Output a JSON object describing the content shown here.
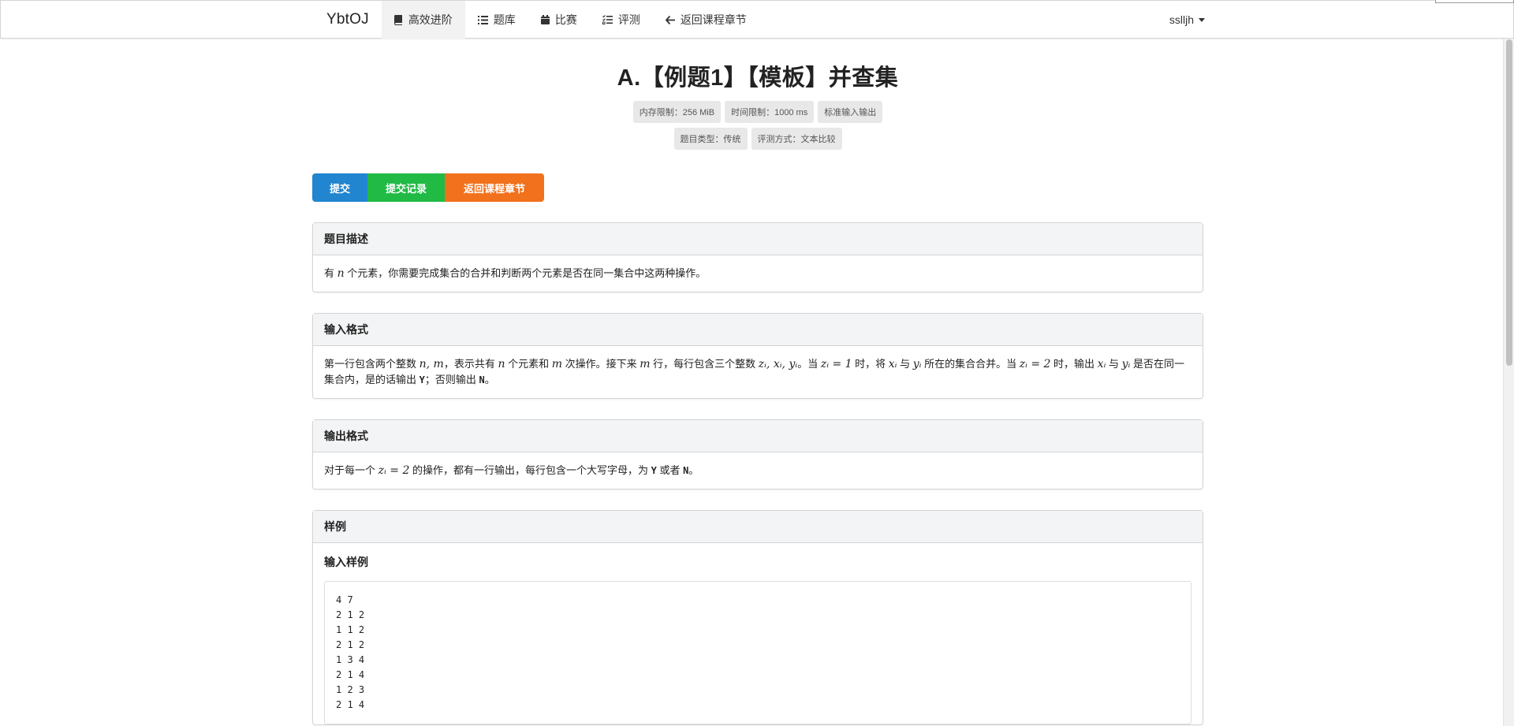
{
  "nav": {
    "brand": "YbtOJ",
    "items": [
      {
        "label": "高效进阶",
        "icon": "book-icon",
        "active": true
      },
      {
        "label": "题库",
        "icon": "list-icon",
        "active": false
      },
      {
        "label": "比赛",
        "icon": "calendar-icon",
        "active": false
      },
      {
        "label": "评测",
        "icon": "tasks-icon",
        "active": false
      },
      {
        "label": "返回课程章节",
        "icon": "arrow-left-icon",
        "active": false
      }
    ],
    "user": "sslljh"
  },
  "problem": {
    "title": "A.【例题1】【模板】并查集",
    "labels_row1": [
      "内存限制：256 MiB",
      "时间限制：1000 ms",
      "标准输入输出"
    ],
    "labels_row2": [
      "题目类型：传统",
      "评测方式：文本比较"
    ]
  },
  "buttons": {
    "submit": "提交",
    "records": "提交记录",
    "back": "返回课程章节"
  },
  "sections": {
    "description": {
      "title": "题目描述",
      "t1": "有 ",
      "m1": "n",
      "t2": " 个元素，你需要完成集合的合并和判断两个元素是否在同一集合中这两种操作。"
    },
    "input_format": {
      "title": "输入格式",
      "t1": "第一行包含两个整数 ",
      "m1": "n, m",
      "t2": "，表示共有 ",
      "m2": "n",
      "t3": " 个元素和 ",
      "m3": "m",
      "t4": " 次操作。接下来 ",
      "m4": "m",
      "t5": " 行，每行包含三个整数 ",
      "m5": "zᵢ, xᵢ, yᵢ",
      "t6": "。当 ",
      "m6": "zᵢ = 1",
      "t7": " 时，将 ",
      "m7": "xᵢ",
      "t8": " 与 ",
      "m8": "yᵢ",
      "t9": " 所在的集合合并。当 ",
      "m9": "zᵢ = 2",
      "t10": " 时，输出 ",
      "m10": "xᵢ",
      "t11": " 与 ",
      "m11": "yᵢ",
      "t12": " 是否在同一集合内，是的话输出 ",
      "c1": "Y",
      "t13": "；否则输出 ",
      "c2": "N",
      "t14": "。"
    },
    "output_format": {
      "title": "输出格式",
      "t1": "对于每一个 ",
      "m1": "zᵢ = 2",
      "t2": " 的操作，都有一行输出，每行包含一个大写字母，为 ",
      "c1": "Y",
      "t3": " 或者 ",
      "c2": "N",
      "t4": "。"
    },
    "samples": {
      "title": "样例",
      "input_title": "输入样例",
      "input_lines": [
        "4 7",
        "2 1 2",
        "1 1 2",
        "2 1 2",
        "1 3 4",
        "2 1 4",
        "1 2 3",
        "2 1 4"
      ]
    }
  },
  "colors": {
    "blue": "#2185d0",
    "green": "#21ba45",
    "orange": "#f2711c"
  }
}
